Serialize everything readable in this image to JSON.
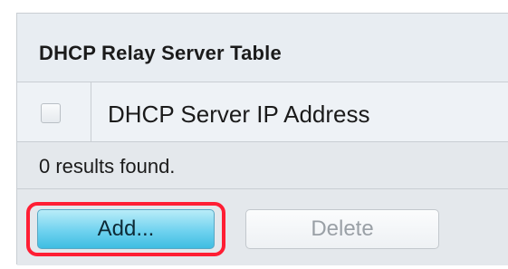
{
  "table": {
    "title": "DHCP Relay Server Table",
    "columns": [
      "DHCP Server IP Address"
    ],
    "status": "0 results found."
  },
  "buttons": {
    "add_label": "Add...",
    "delete_label": "Delete"
  },
  "colors": {
    "highlight": "#ff1e34",
    "add_button": "#6fd2ef"
  }
}
